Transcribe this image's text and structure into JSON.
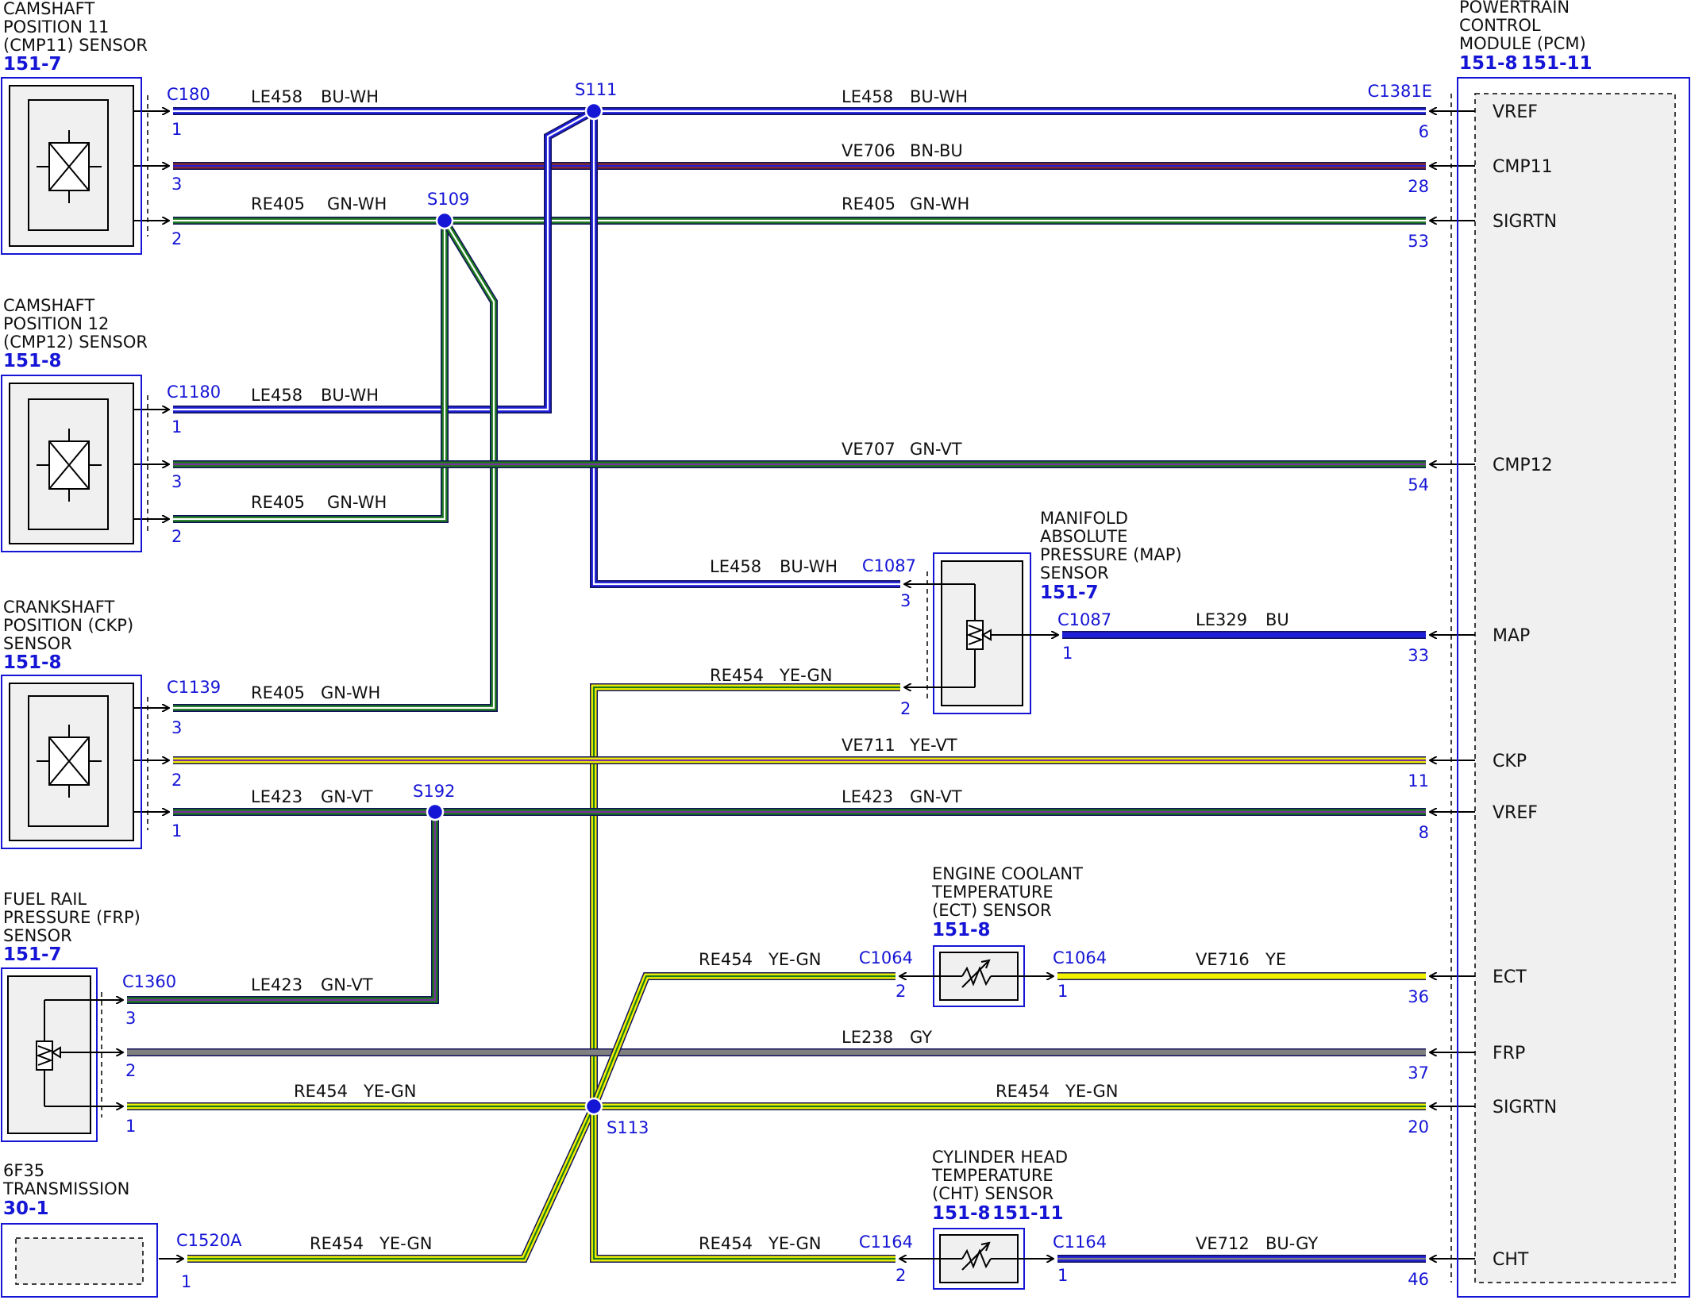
{
  "colors": {
    "BU": "#1f1fd8",
    "WH": "#ffffff",
    "BN": "#8a2b2b",
    "GN": "#1c7a1c",
    "VT": "#7b2fa0",
    "YE": "#f2f200",
    "GY": "#808080",
    "outline": "#10105a",
    "connector_blue": "#1515d6",
    "component_fill": "#f0f0f0"
  },
  "components": {
    "cmp11": {
      "lines": [
        "CAMSHAFT",
        "POSITION 11",
        "(CMP11) SENSOR"
      ],
      "refs": [
        "151-7"
      ],
      "icon": "sensor-x-icon"
    },
    "cmp12": {
      "lines": [
        "CAMSHAFT",
        "POSITION 12",
        "(CMP12) SENSOR"
      ],
      "refs": [
        "151-8"
      ],
      "icon": "sensor-x-icon"
    },
    "ckp": {
      "lines": [
        "CRANKSHAFT",
        "POSITION (CKP)",
        "SENSOR"
      ],
      "refs": [
        "151-8"
      ],
      "icon": "sensor-x-icon"
    },
    "frp": {
      "lines": [
        "FUEL RAIL",
        "PRESSURE (FRP)",
        "SENSOR"
      ],
      "refs": [
        "151-7"
      ],
      "icon": "potentiometer-icon"
    },
    "trans": {
      "lines": [
        "6F35",
        "TRANSMISSION"
      ],
      "refs": [
        "30-1"
      ],
      "icon": ""
    },
    "map": {
      "lines": [
        "MANIFOLD",
        "ABSOLUTE",
        "PRESSURE (MAP)",
        "SENSOR"
      ],
      "refs": [
        "151-7"
      ],
      "icon": "potentiometer-icon"
    },
    "ect": {
      "lines": [
        "ENGINE COOLANT",
        "TEMPERATURE",
        "(ECT) SENSOR"
      ],
      "refs": [
        "151-8"
      ],
      "icon": "thermistor-icon"
    },
    "cht": {
      "lines": [
        "CYLINDER HEAD",
        "TEMPERATURE",
        "(CHT) SENSOR"
      ],
      "refs": [
        "151-8",
        "151-11"
      ],
      "icon": "thermistor-icon"
    },
    "pcm": {
      "lines": [
        "POWERTRAIN",
        "CONTROL",
        "MODULE (PCM)"
      ],
      "refs": [
        "151-8",
        "151-11"
      ]
    }
  },
  "pcm_signals": [
    "VREF",
    "CMP11",
    "SIGRTN",
    "CMP12",
    "MAP",
    "CKP",
    "VREF",
    "ECT",
    "FRP",
    "SIGRTN",
    "CHT"
  ],
  "pcm_pins": [
    "6",
    "28",
    "53",
    "54",
    "33",
    "11",
    "8",
    "36",
    "37",
    "20",
    "46"
  ],
  "pcm_connector": "C1381E",
  "connectors": {
    "cmp11": {
      "id": "C180",
      "pins": [
        "1",
        "3",
        "2"
      ]
    },
    "cmp12": {
      "id": "C1180",
      "pins": [
        "1",
        "3",
        "2"
      ]
    },
    "ckp": {
      "id": "C1139",
      "pins": [
        "3",
        "2",
        "1"
      ]
    },
    "frp": {
      "id": "C1360",
      "pins": [
        "3",
        "2",
        "1"
      ]
    },
    "trans": {
      "id": "C1520A",
      "pins": [
        "1"
      ]
    },
    "map_left": {
      "id": "C1087",
      "pins": [
        "3",
        "2"
      ]
    },
    "map_right": {
      "id": "C1087",
      "pins": [
        "1"
      ]
    },
    "ect_left": {
      "id": "C1064",
      "pins": [
        "2"
      ]
    },
    "ect_right": {
      "id": "C1064",
      "pins": [
        "1"
      ]
    },
    "cht_left": {
      "id": "C1164",
      "pins": [
        "2"
      ]
    },
    "cht_right": {
      "id": "C1164",
      "pins": [
        "1"
      ]
    }
  },
  "splices": {
    "s111": "S111",
    "s109": "S109",
    "s192": "S192",
    "s113": "S113"
  },
  "wires": {
    "le458_cmp11": {
      "circuit": "LE458",
      "color": "BU-WH"
    },
    "le458_pcm": {
      "circuit": "LE458",
      "color": "BU-WH"
    },
    "ve706": {
      "circuit": "VE706",
      "color": "BN-BU"
    },
    "re405_cmp11": {
      "circuit": "RE405",
      "color": "GN-WH"
    },
    "re405_pcm": {
      "circuit": "RE405",
      "color": "GN-WH"
    },
    "le458_cmp12": {
      "circuit": "LE458",
      "color": "BU-WH"
    },
    "ve707": {
      "circuit": "VE707",
      "color": "GN-VT"
    },
    "re405_cmp12": {
      "circuit": "RE405",
      "color": "GN-WH"
    },
    "le458_map": {
      "circuit": "LE458",
      "color": "BU-WH"
    },
    "le329": {
      "circuit": "LE329",
      "color": "BU"
    },
    "re454_map": {
      "circuit": "RE454",
      "color": "YE-GN"
    },
    "re405_ckp": {
      "circuit": "RE405",
      "color": "GN-WH"
    },
    "ve711": {
      "circuit": "VE711",
      "color": "YE-VT"
    },
    "le423_ckp": {
      "circuit": "LE423",
      "color": "GN-VT"
    },
    "le423_pcm": {
      "circuit": "LE423",
      "color": "GN-VT"
    },
    "re454_ect": {
      "circuit": "RE454",
      "color": "YE-GN"
    },
    "ve716": {
      "circuit": "VE716",
      "color": "YE"
    },
    "le423_frp": {
      "circuit": "LE423",
      "color": "GN-VT"
    },
    "le238": {
      "circuit": "LE238",
      "color": "GY"
    },
    "re454_frp": {
      "circuit": "RE454",
      "color": "YE-GN"
    },
    "re454_pcm": {
      "circuit": "RE454",
      "color": "YE-GN"
    },
    "re454_trans": {
      "circuit": "RE454",
      "color": "YE-GN"
    },
    "re454_cht": {
      "circuit": "RE454",
      "color": "YE-GN"
    },
    "ve712": {
      "circuit": "VE712",
      "color": "BU-GY"
    }
  }
}
